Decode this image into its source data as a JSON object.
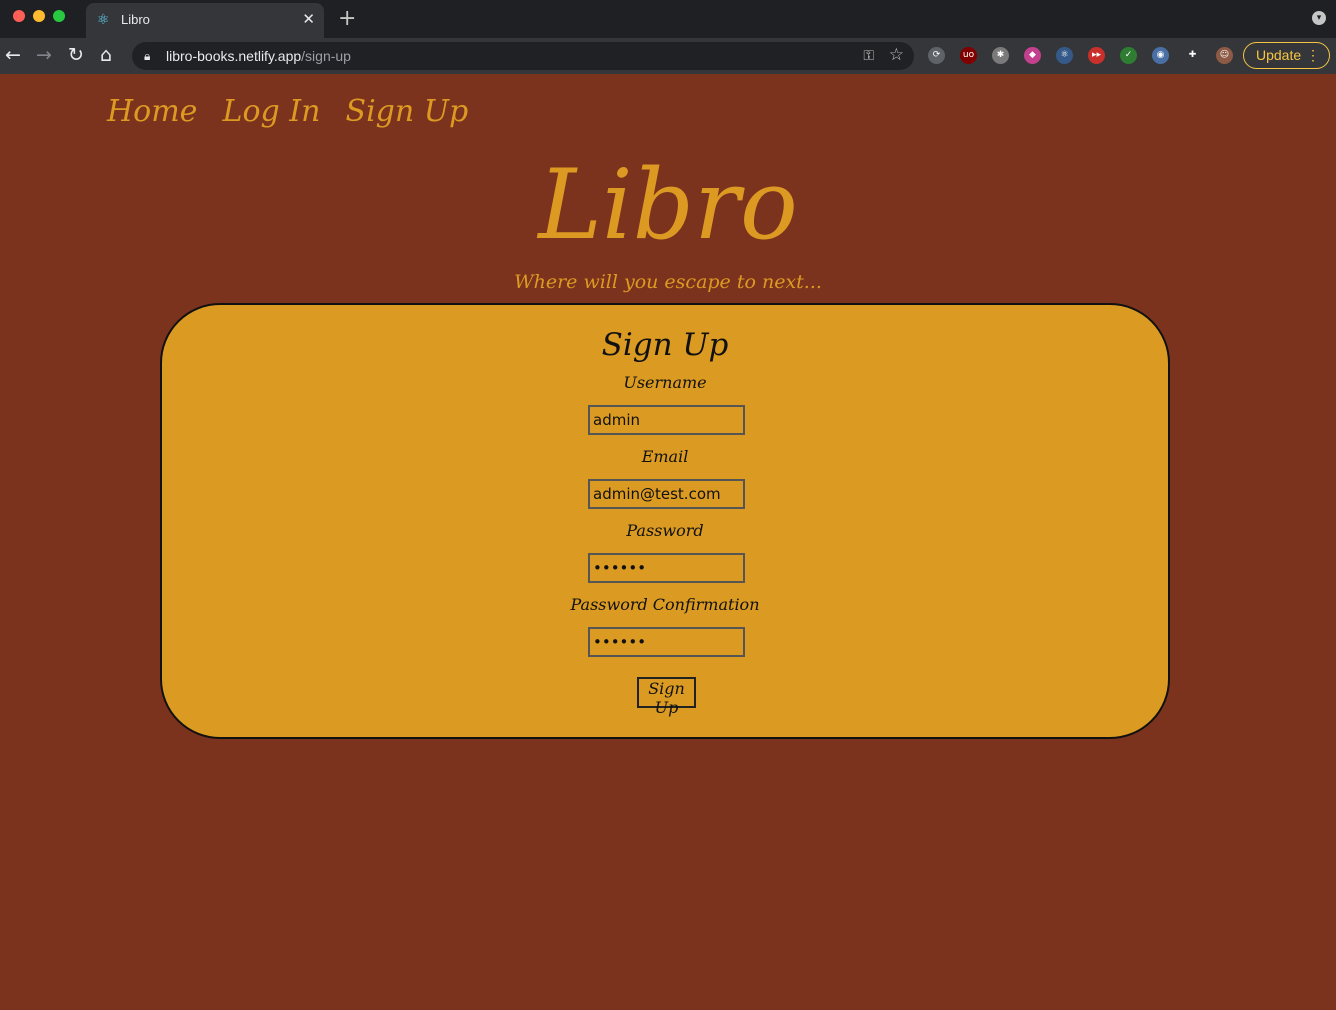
{
  "browser": {
    "tab_title": "Libro",
    "url_host": "libro-books.netlify.app",
    "url_path": "/sign-up",
    "update_label": "Update",
    "extensions": [
      {
        "name": "extension-icon-1",
        "color": "#5f6368",
        "glyph": "⟳"
      },
      {
        "name": "ublock-icon",
        "color": "#800000",
        "glyph": "uo"
      },
      {
        "name": "octopus-icon",
        "color": "#7a7a7a",
        "glyph": "✱"
      },
      {
        "name": "color-picker-icon",
        "color": "#c2408d",
        "glyph": "◆"
      },
      {
        "name": "react-devtools-icon",
        "color": "#355a8a",
        "glyph": "⚛"
      },
      {
        "name": "video-speed-icon",
        "color": "#c9302c",
        "glyph": "▸▸"
      },
      {
        "name": "extension-icon-2",
        "color": "#2e7d32",
        "glyph": "✓"
      },
      {
        "name": "extension-icon-3",
        "color": "#4a6fa5",
        "glyph": "◉"
      },
      {
        "name": "extensions-puzzle-icon",
        "color": "#35363a",
        "glyph": "✚"
      },
      {
        "name": "profile-avatar-icon",
        "color": "#8d5b45",
        "glyph": "☺"
      }
    ]
  },
  "nav": {
    "home": "Home",
    "login": "Log In",
    "signup": "Sign Up"
  },
  "brand": {
    "title": "Libro",
    "tagline": "Where will you escape to next..."
  },
  "form": {
    "title": "Sign Up",
    "username_label": "Username",
    "username_value": "admin",
    "email_label": "Email",
    "email_value": "admin@test.com",
    "password_label": "Password",
    "password_value": "aaaaaa",
    "confirmation_label": "Password Confirmation",
    "confirmation_value": "aaaaaa",
    "submit_label": "Sign Up"
  },
  "colors": {
    "background": "#7b331d",
    "accent": "#dd9a23",
    "card": "#db9a22"
  }
}
